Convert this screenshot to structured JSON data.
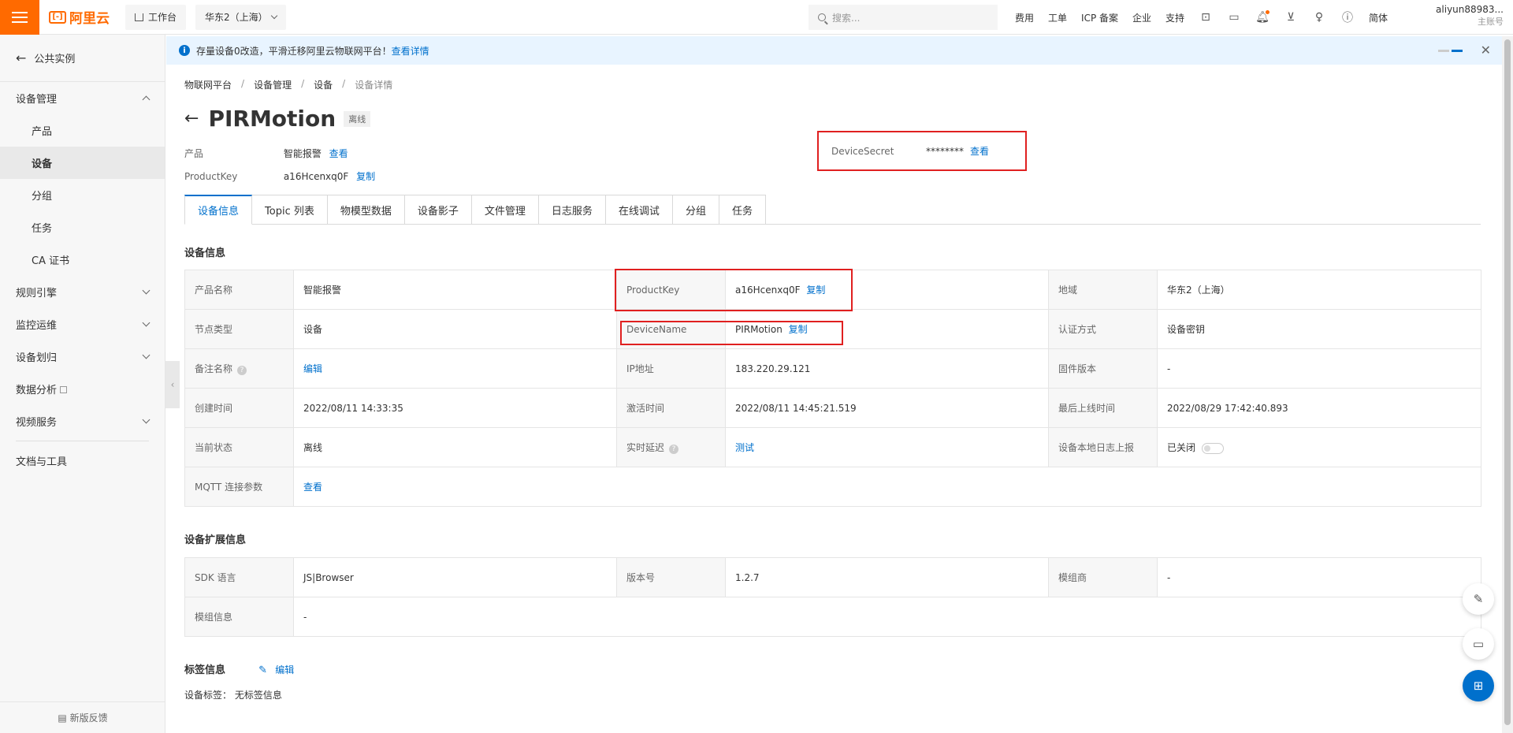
{
  "header": {
    "logo_text": "阿里云",
    "workbench_label": "工作台",
    "region_label": "华东2（上海）",
    "search_placeholder": "搜索...",
    "links": [
      "费用",
      "工单",
      "ICP 备案",
      "企业",
      "支持"
    ],
    "lang_label": "简体",
    "user_name": "aliyun88983...",
    "user_role": "主账号"
  },
  "sidebar": {
    "back_label": "公共实例",
    "group_device_mgmt": "设备管理",
    "items": [
      "产品",
      "设备",
      "分组",
      "任务",
      "CA 证书"
    ],
    "active_item": "设备",
    "groups": [
      "规则引擎",
      "监控运维",
      "设备划归"
    ],
    "data_analysis": "数据分析",
    "video_service": "视频服务",
    "docs_tools": "文档与工具",
    "feedback": "新版反馈"
  },
  "notice": {
    "text": "存量设备0改造，平滑迁移阿里云物联网平台！",
    "link": "查看详情"
  },
  "breadcrumb": [
    "物联网平台",
    "设备管理",
    "设备",
    "设备详情"
  ],
  "device": {
    "name": "PIRMotion",
    "status_badge": "离线",
    "product_label": "产品",
    "product_value": "智能报警",
    "product_link": "查看",
    "productkey_label": "ProductKey",
    "productkey_value": "a16Hcenxq0F",
    "copy_label": "复制",
    "secret_label": "DeviceSecret",
    "secret_value": "********",
    "secret_link": "查看"
  },
  "tabs": [
    "设备信息",
    "Topic 列表",
    "物模型数据",
    "设备影子",
    "文件管理",
    "日志服务",
    "在线调试",
    "分组",
    "任务"
  ],
  "info_section": {
    "title": "设备信息",
    "rows": [
      [
        "产品名称",
        "智能报警",
        "ProductKey",
        "a16Hcenxq0F",
        "地域",
        "华东2（上海）"
      ],
      [
        "节点类型",
        "设备",
        "DeviceName",
        "PIRMotion",
        "认证方式",
        "设备密钥"
      ],
      [
        "备注名称",
        "编辑",
        "IP地址",
        "183.220.29.121",
        "固件版本",
        "-"
      ],
      [
        "创建时间",
        "2022/08/11 14:33:35",
        "激活时间",
        "2022/08/11 14:45:21.519",
        "最后上线时间",
        "2022/08/29 17:42:40.893"
      ],
      [
        "当前状态",
        "离线",
        "实时延迟",
        "测试",
        "设备本地日志上报",
        "已关闭"
      ],
      [
        "MQTT 连接参数",
        "查看",
        "",
        "",
        "",
        ""
      ]
    ]
  },
  "ext_section": {
    "title": "设备扩展信息",
    "rows": [
      [
        "SDK 语言",
        "JS|Browser",
        "版本号",
        "1.2.7",
        "模组商",
        "-"
      ],
      [
        "模组信息",
        "-",
        "",
        "",
        "",
        ""
      ]
    ]
  },
  "tags": {
    "title": "标签信息",
    "edit": "编辑",
    "label": "设备标签：",
    "value": "无标签信息"
  },
  "colors": {
    "brand": "#ff6a00",
    "link": "#0070cc",
    "highlight": "#e02020"
  }
}
